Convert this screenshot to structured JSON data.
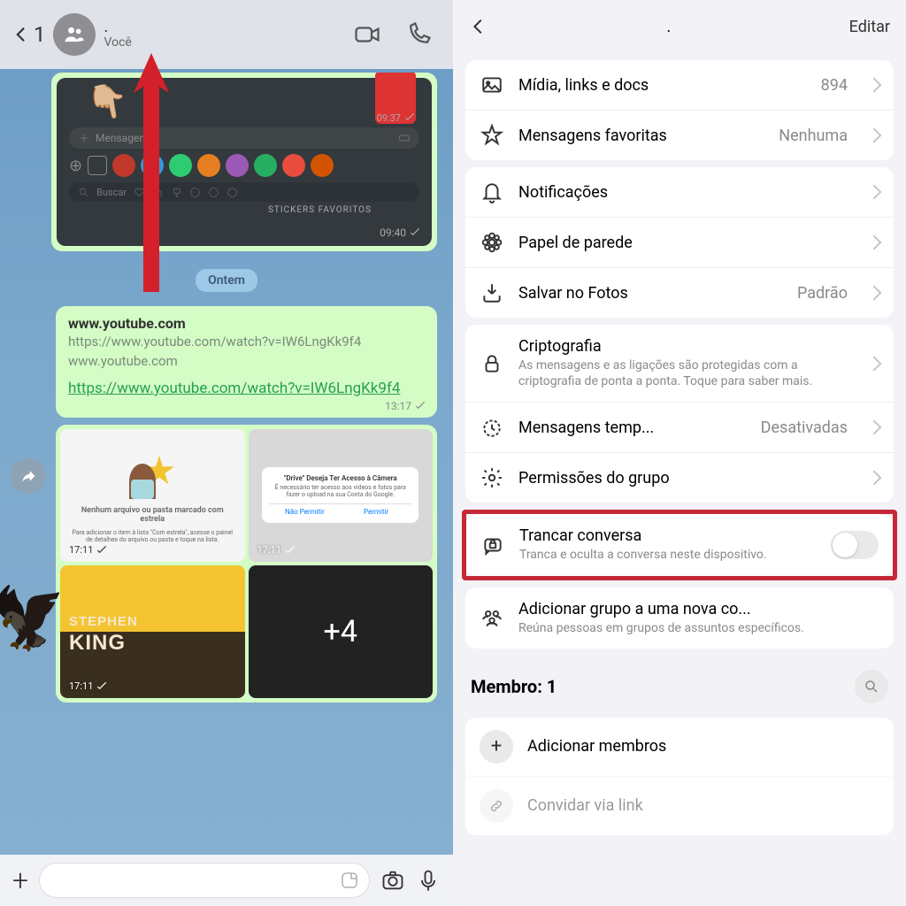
{
  "left": {
    "back_count": "1",
    "header_dot": ".",
    "you_label": "Você",
    "preview": {
      "placeholder": "Mensagem",
      "search": "Buscar",
      "favorites": "STICKERS FAVORITOS",
      "time_top": "09:37",
      "time": "09:40"
    },
    "date_pill": "Ontem",
    "link_card": {
      "title": "www.youtube.com",
      "url1": "https://www.youtube.com/watch?v=IW6LngKk9f4",
      "domain": "www.youtube.com",
      "link": "https://www.youtube.com/watch?v=IW6LngKk9f4",
      "time": "13:17"
    },
    "grid": {
      "c1_label": "Nenhum arquivo ou pasta marcado com estrela",
      "c1_sub": "Para adicionar o item à lista \"Com estrela\", acesse o painel de detalhes do arquivo ou pasta e toque na lista.",
      "c2_title": "\"Drive\" Deseja Ter Acesso à Câmera",
      "c2_sub": "É necessário ter acesso aos vídeos e fotos para fazer o upload na sua Conta do Google.",
      "c2_deny": "Não Permitir",
      "c2_allow": "Permitir",
      "king_top": "STEPHEN",
      "king_bot": "KING",
      "plus4": "+4",
      "t1": "17:11",
      "t2": "17:11",
      "t3": "17:11"
    }
  },
  "right": {
    "edit": "Editar",
    "dot": ".",
    "media_label": "Mídia, links e docs",
    "media_val": "894",
    "starred_label": "Mensagens favoritas",
    "starred_val": "Nenhuma",
    "notif_label": "Notificações",
    "wallpaper_label": "Papel de parede",
    "save_label": "Salvar no Fotos",
    "save_val": "Padrão",
    "crypto_title": "Criptografia",
    "crypto_sub": "As mensagens e as ligações são protegidas com a criptografia de ponta a ponta. Toque para saber mais.",
    "temp_label": "Mensagens temp...",
    "temp_val": "Desativadas",
    "perm_label": "Permissões do grupo",
    "lock_title": "Trancar conversa",
    "lock_sub": "Tranca e oculta a conversa neste dispositivo.",
    "addgroup_title": "Adicionar grupo a uma nova co...",
    "addgroup_sub": "Reúna pessoas em grupos de assuntos específicos.",
    "member_title": "Membro: 1",
    "add_members": "Adicionar membros",
    "invite_link": "Convidar via link"
  }
}
